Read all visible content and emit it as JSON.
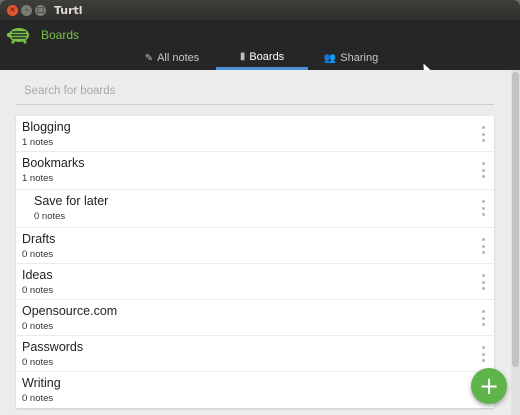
{
  "window": {
    "title": "Turtl",
    "controls": {
      "close": "×",
      "minimize": "–",
      "maximize": "□"
    }
  },
  "header": {
    "logo_icon": "turtle-logo-icon",
    "title": "Boards",
    "tabs": [
      {
        "label": "All notes",
        "icon": "notes-icon",
        "glyph": "✎",
        "active": false
      },
      {
        "label": "Boards",
        "icon": "board-icon",
        "glyph": "▮",
        "active": true
      },
      {
        "label": "Sharing",
        "icon": "users-icon",
        "glyph": "👥",
        "active": false
      }
    ]
  },
  "search": {
    "placeholder": "Search for boards",
    "value": ""
  },
  "boards": [
    {
      "name": "Blogging",
      "count": "1 notes",
      "child": false
    },
    {
      "name": "Bookmarks",
      "count": "1 notes",
      "child": false
    },
    {
      "name": "Save for later",
      "count": "0 notes",
      "child": true
    },
    {
      "name": "Drafts",
      "count": "0 notes",
      "child": false
    },
    {
      "name": "Ideas",
      "count": "0 notes",
      "child": false
    },
    {
      "name": "Opensource.com",
      "count": "0 notes",
      "child": false
    },
    {
      "name": "Passwords",
      "count": "0 notes",
      "child": false
    },
    {
      "name": "Writing",
      "count": "0 notes",
      "child": false
    }
  ],
  "fab": {
    "label": "+",
    "icon": "add-icon"
  },
  "colors": {
    "accent_green": "#79c04a",
    "fab_green": "#5fb44b",
    "tab_underline": "#4a90d9",
    "header_bg": "#262626"
  }
}
